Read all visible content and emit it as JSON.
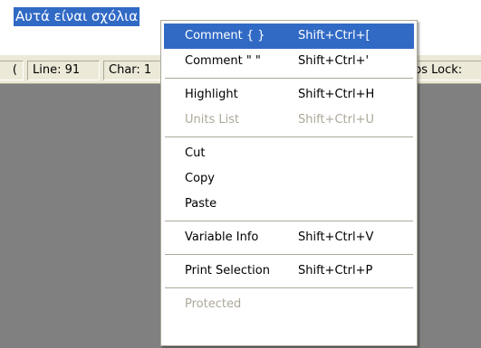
{
  "document": {
    "selected_text": "Αυτά είναι σχόλια"
  },
  "status_bar": {
    "left_fragment": "(",
    "line": "Line: 91",
    "char": "Char: 1",
    "caps_lock": "aps Lock:"
  },
  "context_menu": {
    "items": [
      {
        "label": "Comment { }",
        "shortcut": "Shift+Ctrl+[",
        "state": "highlighted"
      },
      {
        "label": "Comment \" \"",
        "shortcut": "Shift+Ctrl+'",
        "state": "enabled"
      },
      {
        "label": "Highlight",
        "shortcut": "Shift+Ctrl+H",
        "state": "enabled"
      },
      {
        "label": "Units List",
        "shortcut": "Shift+Ctrl+U",
        "state": "disabled"
      },
      {
        "label": "Cut",
        "shortcut": "",
        "state": "enabled"
      },
      {
        "label": "Copy",
        "shortcut": "",
        "state": "enabled"
      },
      {
        "label": "Paste",
        "shortcut": "",
        "state": "enabled"
      },
      {
        "label": "Variable Info",
        "shortcut": "Shift+Ctrl+V",
        "state": "enabled"
      },
      {
        "label": "Print Selection",
        "shortcut": "Shift+Ctrl+P",
        "state": "enabled"
      },
      {
        "label": "Protected",
        "shortcut": "",
        "state": "disabled"
      }
    ]
  },
  "colors": {
    "selection": "#316ac5",
    "workspace": "#808080",
    "status_bar": "#ece9d8",
    "disabled_text": "#aca899"
  }
}
